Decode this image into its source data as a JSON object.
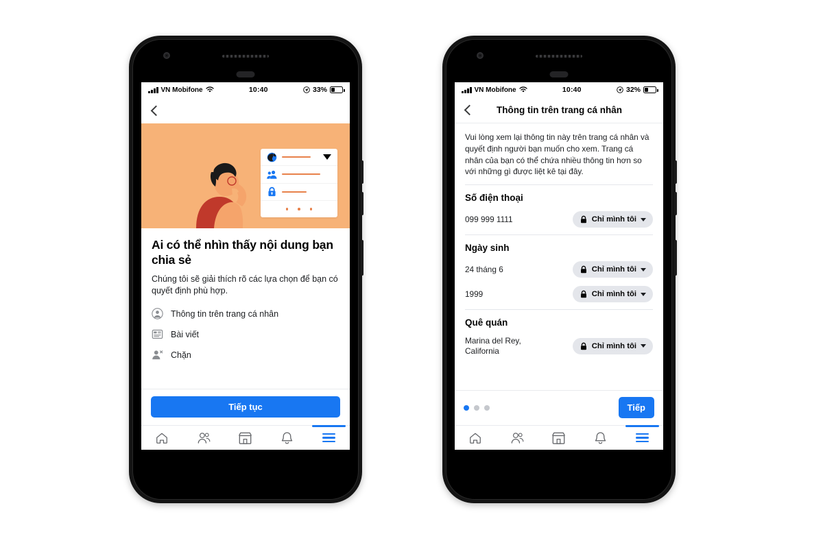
{
  "colors": {
    "brand_blue": "#1877f2",
    "illustration_bg": "#f7b277",
    "pill_bg": "#e4e6eb",
    "text_primary": "#050505",
    "shirt_red": "#c0392b",
    "skin": "#f5a46b",
    "hair": "#1a1a1a",
    "accent_orange": "#e8814a"
  },
  "left_phone": {
    "status_bar": {
      "carrier": "VN Mobifone",
      "time": "10:40",
      "battery_percent": "33%",
      "signal_icon": "signal-bars-icon",
      "wifi_icon": "wifi-icon",
      "location_icon": "location-services-icon",
      "battery_icon": "battery-icon"
    },
    "navbar": {
      "back_icon": "chevron-left-icon",
      "title": ""
    },
    "illustration": {
      "name": "privacy-checkup-illustration",
      "rows": [
        {
          "icon": "globe-icon",
          "caret": "dropdown-caret-icon"
        },
        {
          "icon": "friends-icon"
        },
        {
          "icon": "lock-icon"
        }
      ],
      "dots_count": 3
    },
    "headline": "Ai có thể nhìn thấy nội dung bạn chia sẻ",
    "subtitle": "Chúng tôi sẽ giải thích rõ các lựa chọn để bạn có quyết định phù hợp.",
    "features": [
      {
        "icon": "profile-circle-icon",
        "label": "Thông tin trên trang cá nhân"
      },
      {
        "icon": "posts-icon",
        "label": "Bài viết"
      },
      {
        "icon": "block-user-icon",
        "label": "Chặn"
      }
    ],
    "cta_label": "Tiếp tục"
  },
  "right_phone": {
    "status_bar": {
      "carrier": "VN Mobifone",
      "time": "10:40",
      "battery_percent": "32%",
      "signal_icon": "signal-bars-icon",
      "wifi_icon": "wifi-icon",
      "location_icon": "location-services-icon",
      "battery_icon": "battery-icon"
    },
    "navbar": {
      "back_icon": "chevron-left-icon",
      "title": "Thông tin trên trang cá nhân"
    },
    "description": "Vui lòng xem lại thông tin này trên trang cá nhân và quyết định người bạn muốn cho xem. Trang cá nhân của bạn có thể chứa nhiều thông tin hơn so với những gì được liệt kê tại đây.",
    "sections": [
      {
        "title": "Số điện thoại",
        "rows": [
          {
            "value": "099 999 1111",
            "audience": "Chỉ mình tôi",
            "audience_icon": "lock-icon"
          }
        ]
      },
      {
        "title": "Ngày sinh",
        "rows": [
          {
            "value": "24 tháng 6",
            "audience": "Chỉ mình tôi",
            "audience_icon": "lock-icon"
          },
          {
            "value": "1999",
            "audience": "Chỉ mình tôi",
            "audience_icon": "lock-icon"
          }
        ]
      },
      {
        "title": "Quê quán",
        "rows": [
          {
            "value": "Marina del Rey, California",
            "audience": "Chỉ mình tôi",
            "audience_icon": "lock-icon"
          }
        ]
      }
    ],
    "pager": {
      "dots": 3,
      "active_index": 0,
      "next_label": "Tiếp"
    }
  },
  "tabbar": {
    "items": [
      {
        "icon": "home-icon",
        "active": false
      },
      {
        "icon": "friends-icon",
        "active": false
      },
      {
        "icon": "marketplace-icon",
        "active": false
      },
      {
        "icon": "notifications-bell-icon",
        "active": false
      },
      {
        "icon": "menu-hamburger-icon",
        "active": true
      }
    ]
  }
}
